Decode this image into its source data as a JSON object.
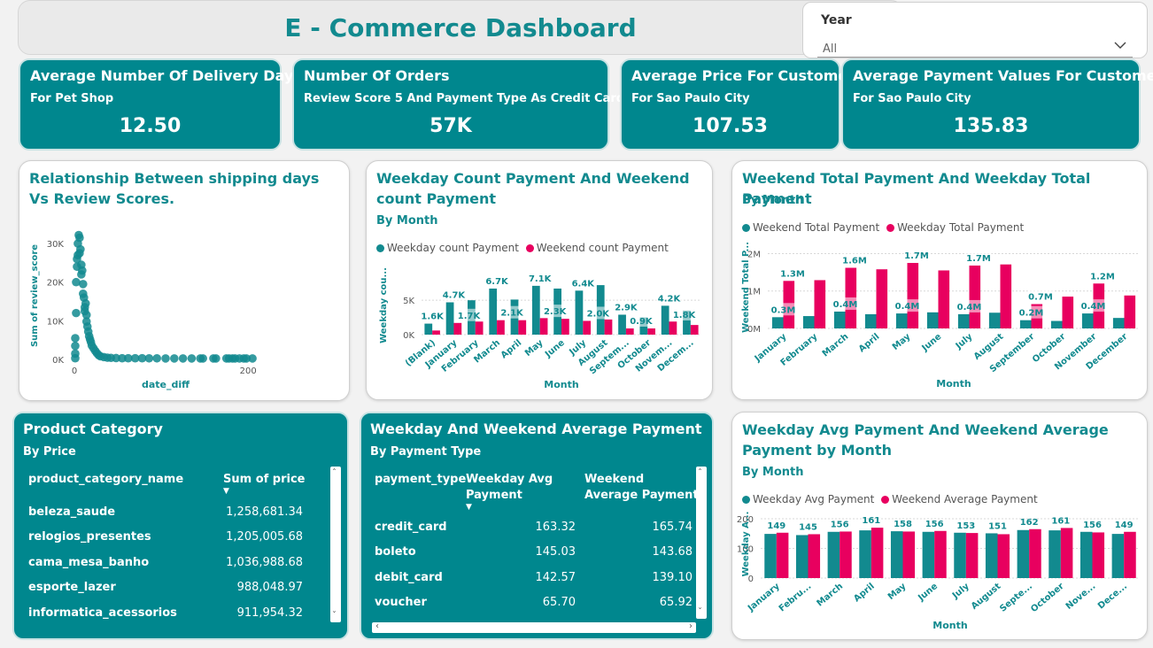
{
  "header": {
    "title": "E - Commerce Dashboard"
  },
  "slicer": {
    "label": "Year",
    "value": "All",
    "icon": "chevron-down-icon"
  },
  "kpis": [
    {
      "title": "Average Number Of Delivery Days",
      "subtitle": "For Pet Shop",
      "value": "12.50"
    },
    {
      "title": "Number Of Orders",
      "subtitle": "Review Score 5 And Payment Type As Credit Card",
      "value": "57K"
    },
    {
      "title": "Average Price For Customer",
      "subtitle": "For Sao Paulo City",
      "value": "107.53"
    },
    {
      "title": "Average Payment Values For Customer",
      "subtitle": "For Sao Paulo City",
      "value": "135.83"
    }
  ],
  "colors": {
    "teal": "#128a8f",
    "pink": "#e8005f",
    "card_teal": "#00878e"
  },
  "scatter": {
    "title": "Relationship Between shipping days Vs Review Scores.",
    "chart_data": {
      "type": "scatter",
      "xlabel": "date_diff",
      "ylabel": "Sum of review_score",
      "xlim": [
        0,
        210
      ],
      "ylim": [
        0,
        33000
      ],
      "yticks": [
        "0K",
        "10K",
        "20K",
        "30K"
      ],
      "ytick_values": [
        0,
        10000,
        20000,
        30000
      ],
      "xticks": [
        "0",
        "200"
      ],
      "xtick_values": [
        0,
        200
      ],
      "points": [
        [
          1,
          5500
        ],
        [
          1,
          3500
        ],
        [
          1,
          1500
        ],
        [
          1,
          300
        ],
        [
          2,
          20000
        ],
        [
          2,
          12000
        ],
        [
          3,
          24000
        ],
        [
          3,
          26000
        ],
        [
          4,
          30000
        ],
        [
          4,
          27000
        ],
        [
          5,
          32200
        ],
        [
          6,
          31500
        ],
        [
          6,
          27500
        ],
        [
          7,
          28500
        ],
        [
          8,
          24500
        ],
        [
          8,
          22000
        ],
        [
          9,
          23000
        ],
        [
          10,
          19500
        ],
        [
          10,
          17000
        ],
        [
          11,
          16000
        ],
        [
          12,
          13500
        ],
        [
          12,
          12500
        ],
        [
          13,
          14500
        ],
        [
          14,
          11500
        ],
        [
          14,
          9800
        ],
        [
          15,
          8500
        ],
        [
          16,
          7200
        ],
        [
          17,
          6000
        ],
        [
          18,
          5200
        ],
        [
          19,
          4500
        ],
        [
          20,
          3600
        ],
        [
          22,
          2900
        ],
        [
          24,
          2200
        ],
        [
          26,
          1600
        ],
        [
          28,
          1100
        ],
        [
          30,
          800
        ],
        [
          34,
          600
        ],
        [
          38,
          450
        ],
        [
          42,
          400
        ],
        [
          48,
          350
        ],
        [
          55,
          300
        ],
        [
          62,
          300
        ],
        [
          70,
          300
        ],
        [
          78,
          300
        ],
        [
          86,
          280
        ],
        [
          95,
          280
        ],
        [
          105,
          250
        ],
        [
          115,
          250
        ],
        [
          125,
          250
        ],
        [
          135,
          250
        ],
        [
          145,
          250
        ],
        [
          148,
          250
        ],
        [
          160,
          250
        ],
        [
          163,
          250
        ],
        [
          175,
          250
        ],
        [
          178,
          250
        ],
        [
          182,
          250
        ],
        [
          185,
          250
        ],
        [
          190,
          250
        ],
        [
          195,
          250
        ],
        [
          198,
          250
        ],
        [
          205,
          250
        ]
      ]
    }
  },
  "weekday_count": {
    "title": "Weekday Count Payment And Weekend count Payment",
    "subtitle": "By Month",
    "legend": [
      "Weekday count Payment",
      "Weekend count Payment"
    ],
    "chart_data": {
      "type": "bar",
      "ylabel": "Weekday cou...",
      "xlabel": "Month",
      "ylim": [
        0,
        8500
      ],
      "yticks": [
        "0K",
        "5K"
      ],
      "ytick_values": [
        0,
        5000
      ],
      "categories": [
        "(Blank)",
        "January",
        "February",
        "March",
        "April",
        "May",
        "June",
        "July",
        "August",
        "Septem...",
        "October",
        "Novem...",
        "Decem..."
      ],
      "series": [
        {
          "name": "Weekday count Payment",
          "values": [
            1600,
            4700,
            5000,
            6700,
            5100,
            7100,
            6700,
            6400,
            7200,
            2900,
            2500,
            4200,
            3500
          ]
        },
        {
          "name": "Weekend count Payment",
          "values": [
            600,
            1700,
            1900,
            2100,
            2100,
            2400,
            2300,
            2000,
            2200,
            900,
            900,
            1900,
            1400
          ]
        }
      ],
      "labels": [
        {
          "text": "1.6K",
          "cat": 0,
          "v": 1600
        },
        {
          "text": "4.7K",
          "cat": 1,
          "v": 4700
        },
        {
          "text": "1.7K",
          "cat": 1.7,
          "v": 1700
        },
        {
          "text": "6.7K",
          "cat": 3,
          "v": 6700
        },
        {
          "text": "2.1K",
          "cat": 3.7,
          "v": 2100
        },
        {
          "text": "7.1K",
          "cat": 5,
          "v": 7100
        },
        {
          "text": "2.3K",
          "cat": 5.7,
          "v": 2300
        },
        {
          "text": "6.4K",
          "cat": 7,
          "v": 6400
        },
        {
          "text": "2.0K",
          "cat": 7.7,
          "v": 2000
        },
        {
          "text": "2.9K",
          "cat": 9,
          "v": 2900
        },
        {
          "text": "0.9K",
          "cat": 9.7,
          "v": 900
        },
        {
          "text": "4.2K",
          "cat": 11,
          "v": 4200
        },
        {
          "text": "1.8K",
          "cat": 11.7,
          "v": 1800
        }
      ]
    }
  },
  "weekend_total": {
    "title": "Weekend Total Payment And Weekday Total Payment",
    "subtitle": "By Month",
    "legend": [
      "Weekend Total Payment",
      "Weekday Total Payment"
    ],
    "chart_data": {
      "type": "bar",
      "ylabel": "Weekend Total P...",
      "xlabel": "Month",
      "ylim": [
        0,
        2200000
      ],
      "yticks": [
        "0M",
        "1M",
        "2M"
      ],
      "ytick_values": [
        0,
        1000000,
        2000000
      ],
      "categories": [
        "January",
        "February",
        "March",
        "April",
        "May",
        "June",
        "July",
        "August",
        "September",
        "October",
        "November",
        "December"
      ],
      "series": [
        {
          "name": "Weekend Total Payment",
          "values": [
            300000,
            330000,
            450000,
            380000,
            400000,
            430000,
            380000,
            420000,
            220000,
            200000,
            400000,
            280000
          ]
        },
        {
          "name": "Weekday Total Payment",
          "values": [
            1270000,
            1290000,
            1620000,
            1580000,
            1750000,
            1550000,
            1680000,
            1710000,
            650000,
            850000,
            1200000,
            880000
          ]
        }
      ],
      "labels": [
        {
          "text": "1.3M",
          "cat": 0.3,
          "v": 1270000
        },
        {
          "text": "0.3M",
          "cat": 0,
          "v": 300000
        },
        {
          "text": "1.6M",
          "cat": 2.3,
          "v": 1620000
        },
        {
          "text": "0.4M",
          "cat": 2,
          "v": 450000
        },
        {
          "text": "1.7M",
          "cat": 4.3,
          "v": 1750000
        },
        {
          "text": "0.4M",
          "cat": 4,
          "v": 400000
        },
        {
          "text": "1.7M",
          "cat": 6.3,
          "v": 1680000
        },
        {
          "text": "0.4M",
          "cat": 6,
          "v": 380000
        },
        {
          "text": "0.7M",
          "cat": 8.3,
          "v": 650000
        },
        {
          "text": "0.2M",
          "cat": 8,
          "v": 220000
        },
        {
          "text": "1.2M",
          "cat": 10.3,
          "v": 1200000
        },
        {
          "text": "0.4M",
          "cat": 10,
          "v": 400000
        }
      ]
    }
  },
  "product_table": {
    "title": "Product Category",
    "subtitle": "By Price",
    "columns": [
      "product_category_name",
      "Sum of price"
    ],
    "rows": [
      [
        "beleza_saude",
        "1,258,681.34"
      ],
      [
        "relogios_presentes",
        "1,205,005.68"
      ],
      [
        "cama_mesa_banho",
        "1,036,988.68"
      ],
      [
        "esporte_lazer",
        "988,048.97"
      ],
      [
        "informatica_acessorios",
        "911,954.32"
      ]
    ]
  },
  "avg_table": {
    "title": "Weekday And Weekend Average Payment",
    "subtitle": "By Payment Type",
    "columns": [
      "payment_type",
      "Weekday Avg Payment",
      "Weekend Average Payment"
    ],
    "rows": [
      [
        "credit_card",
        "163.32",
        "165.74"
      ],
      [
        "boleto",
        "145.03",
        "143.68"
      ],
      [
        "debit_card",
        "142.57",
        "139.10"
      ],
      [
        "voucher",
        "65.70",
        "65.92"
      ]
    ]
  },
  "weekday_avg": {
    "title": "Weekday Avg Payment And Weekend Average Payment by Month",
    "subtitle": "By Month",
    "legend": [
      "Weekday Avg Payment",
      "Weekend Average Payment"
    ],
    "chart_data": {
      "type": "bar",
      "ylabel": "Weekday A...",
      "xlabel": "Month",
      "ylim": [
        0,
        230
      ],
      "yticks": [
        "0",
        "100",
        "200"
      ],
      "ytick_values": [
        0,
        100,
        200
      ],
      "categories": [
        "January",
        "Febru...",
        "March",
        "April",
        "May",
        "June",
        "July",
        "August",
        "Septe...",
        "October",
        "Nove...",
        "Dece..."
      ],
      "series": [
        {
          "name": "Weekday Avg Payment",
          "values": [
            149,
            145,
            156,
            161,
            158,
            156,
            153,
            151,
            162,
            161,
            156,
            149
          ]
        },
        {
          "name": "Weekend Average Payment",
          "values": [
            153,
            148,
            157,
            170,
            157,
            159,
            152,
            148,
            165,
            169,
            154,
            156
          ]
        }
      ],
      "labels": [
        "149",
        "145",
        "156",
        "161",
        "158",
        "156",
        "153",
        "151",
        "162",
        "161",
        "156",
        "149"
      ]
    }
  }
}
